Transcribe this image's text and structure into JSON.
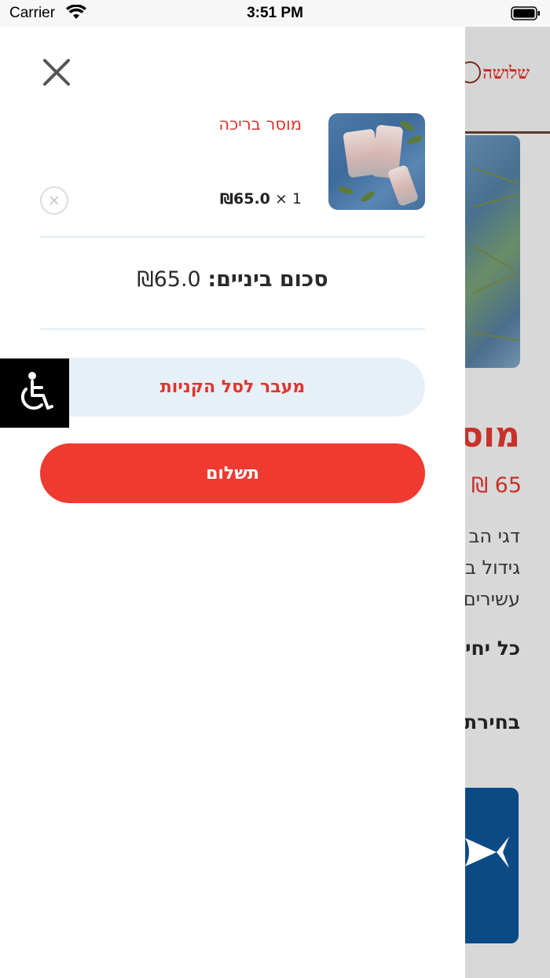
{
  "status_bar": {
    "carrier": "Carrier",
    "time": "3:51 PM",
    "wifi_icon": "wifi-icon",
    "battery_icon": "battery-icon"
  },
  "background_page": {
    "logo_text": "שלושה",
    "product_title": "מוס",
    "price": "65 ₪",
    "description_lines": [
      "דגי הב",
      "גידול ב",
      "עשירים"
    ],
    "bold_line_1": "כל יחי",
    "bold_line_2": "בחירת"
  },
  "accessibility": {
    "icon": "wheelchair-icon"
  },
  "cart": {
    "close_icon": "close-icon",
    "items": [
      {
        "name": "מוסר בריכה",
        "quantity": "1",
        "times": "×",
        "price": "₪65.0",
        "remove_icon": "remove-item-icon"
      }
    ],
    "subtotal_label": "סכום ביניים:",
    "subtotal_value": "₪65.0",
    "view_cart_label": "מעבר לסל הקניות",
    "checkout_label": "תשלום"
  },
  "colors": {
    "accent_red": "#ef3a31",
    "text_red": "#e0342d",
    "button_light": "#e8f0f7"
  }
}
